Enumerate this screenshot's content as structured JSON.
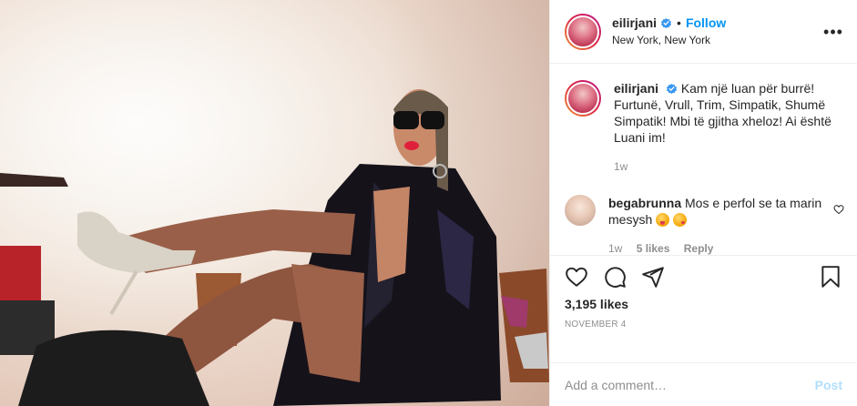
{
  "post": {
    "author": {
      "username": "eilirjani",
      "verified": true,
      "follow_label": "Follow",
      "separator": "•",
      "location": "New York, New York"
    },
    "more_label": "•••",
    "caption": {
      "username": "eilirjani",
      "text": "Kam një luan për burrë! Furtunë, Vrull, Trim, Simpatik, Shumë Simpatik! Mbi të gjitha xheloz! Ai është Luani im!",
      "time": "1w"
    },
    "comments": [
      {
        "username": "begabrunna",
        "text": "Mos e perfol se ta marin mesysh",
        "emojis": [
          "tongue-wink-emoji",
          "kiss-emoji"
        ],
        "time": "1w",
        "likes": "5 likes",
        "reply_label": "Reply"
      }
    ],
    "likes_label": "3,195 likes",
    "date": "November 4",
    "add_comment_placeholder": "Add a comment…",
    "post_button": "Post"
  },
  "colors": {
    "accent": "#0095f6",
    "post_disabled": "#b2dffc",
    "muted": "#8e8e8e",
    "verified": "#3897f0"
  },
  "icons": [
    "verified-badge-icon",
    "more-options-icon",
    "heart-icon",
    "comment-icon",
    "share-icon",
    "bookmark-icon",
    "comment-like-icon"
  ]
}
